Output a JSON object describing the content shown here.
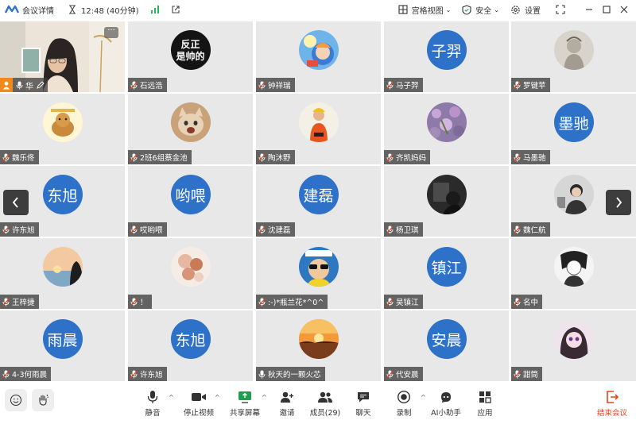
{
  "topbar": {
    "meeting_details": "会议详情",
    "clock": "12:48 (40分钟)",
    "gallery_view": "宫格视图",
    "security": "安全",
    "settings": "设置"
  },
  "self_tile": {
    "name": "华"
  },
  "participants": [
    {
      "name": "石远浩",
      "avatar_text": "反正\n是帅的",
      "avatar_kind": "dark"
    },
    {
      "name": "钟祥瑞",
      "avatar_kind": "photo",
      "photo": "anime"
    },
    {
      "name": "马子羿",
      "avatar_text": "子羿",
      "avatar_kind": "text"
    },
    {
      "name": "罗键苹",
      "avatar_kind": "photo",
      "photo": "sketch"
    },
    {
      "name": "魏乐佟",
      "avatar_kind": "photo",
      "photo": "cartoon"
    },
    {
      "name": "2班6组蔡金池",
      "avatar_kind": "photo",
      "photo": "cat"
    },
    {
      "name": "陶沐野",
      "avatar_kind": "photo",
      "photo": "figure"
    },
    {
      "name": "齐凯妈妈",
      "avatar_kind": "photo",
      "photo": "flowers"
    },
    {
      "name": "马墨驰",
      "avatar_text": "墨驰",
      "avatar_kind": "text"
    },
    {
      "name": "许东旭",
      "avatar_text": "东旭",
      "avatar_kind": "text"
    },
    {
      "name": "哎哟喂",
      "avatar_text": "哟喂",
      "avatar_kind": "text"
    },
    {
      "name": "沈建磊",
      "avatar_text": "建磊",
      "avatar_kind": "text"
    },
    {
      "name": "杨卫琪",
      "avatar_kind": "photo",
      "photo": "dark"
    },
    {
      "name": "魏仁航",
      "avatar_kind": "photo",
      "photo": "boy"
    },
    {
      "name": "王梓捷",
      "avatar_kind": "photo",
      "photo": "sunset-silhouette"
    },
    {
      "name": "！",
      "avatar_kind": "photo",
      "photo": "roses"
    },
    {
      "name": ":-)*瓶兰花*^0^",
      "avatar_kind": "photo",
      "photo": "sunglasses"
    },
    {
      "name": "吴镇江",
      "avatar_text": "镇江",
      "avatar_kind": "text"
    },
    {
      "name": "名中",
      "avatar_kind": "photo",
      "photo": "manga"
    },
    {
      "name": "4-3何雨晨",
      "avatar_text": "雨晨",
      "avatar_kind": "text"
    },
    {
      "name": "许东旭",
      "avatar_text": "东旭",
      "avatar_kind": "text"
    },
    {
      "name": "秋天的一颗火芯",
      "avatar_kind": "photo",
      "photo": "orange-sunset",
      "mic": "on"
    },
    {
      "name": "代安晨",
      "avatar_text": "安晨",
      "avatar_kind": "text"
    },
    {
      "name": "甜筒",
      "avatar_kind": "photo",
      "photo": "doll"
    }
  ],
  "toolbar": {
    "mute": "静音",
    "stop_video": "停止视频",
    "share_screen": "共享屏幕",
    "invite": "邀请",
    "members": "成员(29)",
    "chat": "聊天",
    "record": "录制",
    "ai_assistant": "AI小助手",
    "apps": "应用",
    "end_meeting": "结束会议"
  },
  "colors": {
    "avatar_blue": "#2e71c9",
    "tile_bg": "#e8e8e8",
    "end_red": "#e0441c",
    "host_orange": "#f08a1c",
    "signal_green": "#27b45a"
  }
}
